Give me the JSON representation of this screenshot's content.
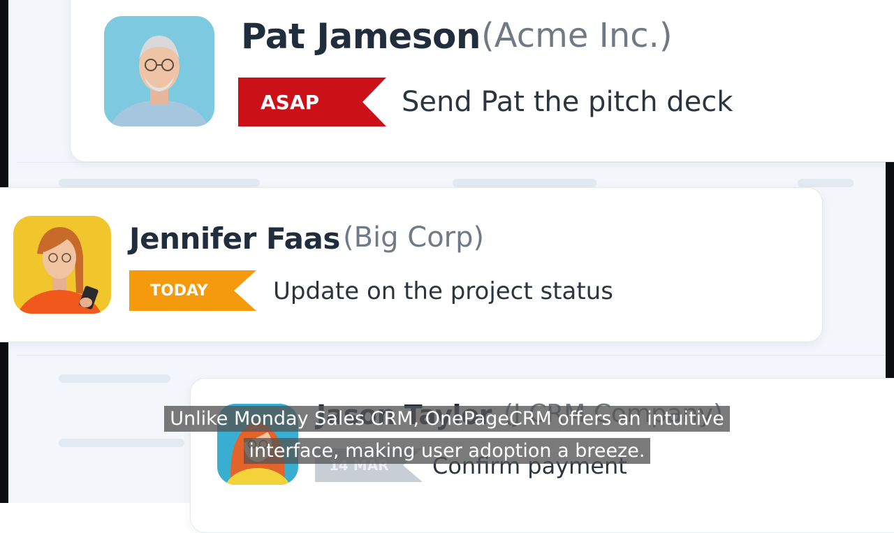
{
  "contacts": [
    {
      "name": "Pat Jameson",
      "company": "(Acme Inc.)",
      "tag": "ASAP",
      "tag_color": "#cc1017",
      "task": "Send Pat the pitch deck"
    },
    {
      "name": "Jennifer Faas",
      "company": "(Big Corp)",
      "tag": "TODAY",
      "tag_color": "#f59a0c",
      "task": "Update on the project status"
    },
    {
      "name": "Jason Taylor",
      "company": "(J CRM Company)",
      "tag": "14 MAR",
      "tag_color": "#c8ced6",
      "task": "Confirm payment"
    }
  ],
  "caption": "Unlike Monday Sales CRM, OnePageCRM offers an intuitive interface, making user adoption a breeze.",
  "icons": [
    "avatar-photo",
    "priority-ribbon"
  ]
}
